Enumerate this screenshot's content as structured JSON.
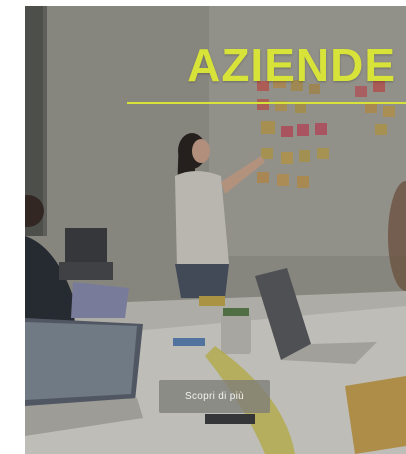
{
  "hero": {
    "title": "AZIENDE",
    "cta_label": "Scopri di più"
  },
  "colors": {
    "accent": "#d8e33a",
    "button_bg": "#7d7e78",
    "button_text": "#f3f3f0"
  }
}
